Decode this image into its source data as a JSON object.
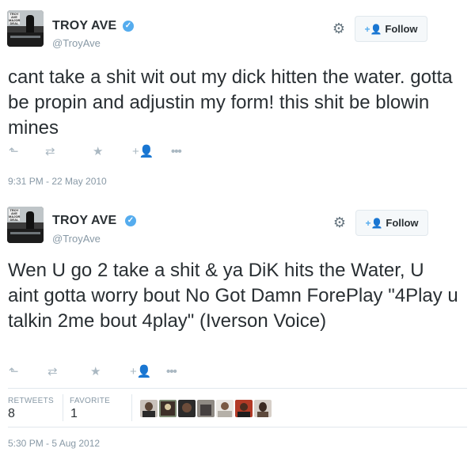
{
  "tweets": [
    {
      "avatar_sign_text": "TROY AVE MAJOR DEAL",
      "name": "TROY AVE",
      "handle": "@TroyAve",
      "follow_label": "Follow",
      "text": "cant take a shit wit out my dick hitten the water. gotta be propin and adjustin my form! this shit be blowin mines",
      "timestamp": "9:31 PM - 22 May 2010",
      "actions": [
        "reply-icon",
        "retweet-icon",
        "favorite-icon",
        "follow-icon",
        "more-icon"
      ]
    },
    {
      "avatar_sign_text": "TROY AVE MAJOR DEAL",
      "name": "TROY AVE",
      "handle": "@TroyAve",
      "follow_label": "Follow",
      "text": "Wen U go 2 take a shit & ya DiK hits the Water, U aint gotta worry bout No Got Damn ForePlay \"4Play u talkin 2me bout 4play\" (Iverson Voice)",
      "timestamp": "5:30 PM - 5 Aug 2012",
      "actions": [
        "reply-icon",
        "retweet-icon",
        "favorite-icon",
        "follow-icon",
        "more-icon"
      ],
      "stats": {
        "retweets_label": "RETWEETS",
        "retweets_value": "8",
        "favorites_label": "FAVORITE",
        "favorites_value": "1"
      },
      "favorited_by_avatar_count": 7
    }
  ],
  "colors": {
    "verified": "#55acee",
    "text": "#292f33",
    "muted": "#8899a6",
    "action_icon": "#aab8c2",
    "border": "#e1e8ed"
  }
}
